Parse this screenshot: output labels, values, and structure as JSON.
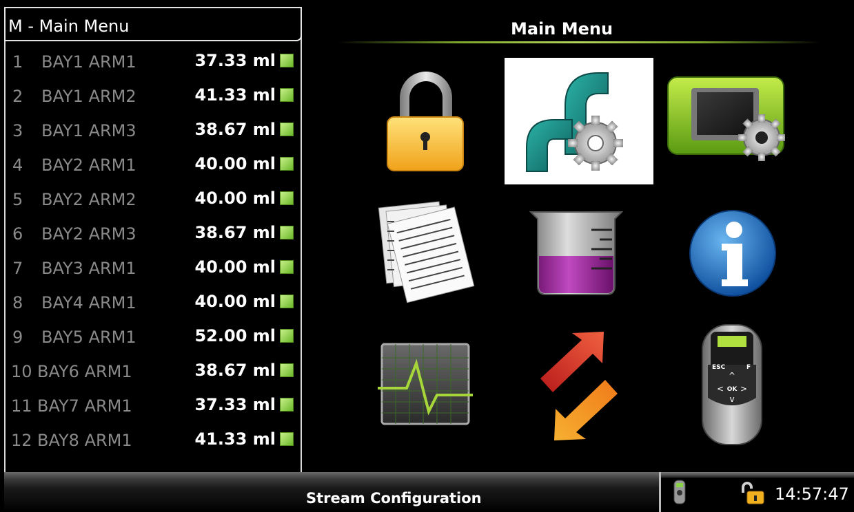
{
  "left_panel": {
    "title": "M - Main Menu",
    "rows": [
      {
        "num": "1",
        "name": "BAY1 ARM1",
        "value": "37.33 ml"
      },
      {
        "num": "2",
        "name": "BAY1 ARM2",
        "value": "41.33 ml"
      },
      {
        "num": "3",
        "name": "BAY1 ARM3",
        "value": "38.67 ml"
      },
      {
        "num": "4",
        "name": "BAY2 ARM1",
        "value": "40.00 ml"
      },
      {
        "num": "5",
        "name": "BAY2 ARM2",
        "value": "40.00 ml"
      },
      {
        "num": "6",
        "name": "BAY2 ARM3",
        "value": "38.67 ml"
      },
      {
        "num": "7",
        "name": "BAY3 ARM1",
        "value": "40.00 ml"
      },
      {
        "num": "8",
        "name": "BAY4 ARM1",
        "value": "40.00 ml"
      },
      {
        "num": "9",
        "name": "BAY5 ARM1",
        "value": "52.00 ml"
      },
      {
        "num": "10",
        "name": "BAY6 ARM1",
        "value": "38.67 ml"
      },
      {
        "num": "11",
        "name": "BAY7 ARM1",
        "value": "37.33 ml"
      },
      {
        "num": "12",
        "name": "BAY8 ARM1",
        "value": "41.33 ml"
      }
    ]
  },
  "main": {
    "title": "Main Menu",
    "icons": [
      "lock-icon",
      "stream-configuration-icon",
      "device-settings-icon",
      "documents-icon",
      "beaker-icon",
      "info-icon",
      "trend-chart-icon",
      "transfer-arrows-icon",
      "keypad-device-icon"
    ],
    "selected_icon": "stream-configuration-icon"
  },
  "bottom": {
    "selected_label": "Stream Configuration",
    "time": "14:57:47"
  },
  "colors": {
    "indicator_green": "#8ad44a",
    "accent_line": "#8fb83a",
    "pipe_teal": "#1f8a85",
    "lock_gold": "#f4b62a"
  }
}
